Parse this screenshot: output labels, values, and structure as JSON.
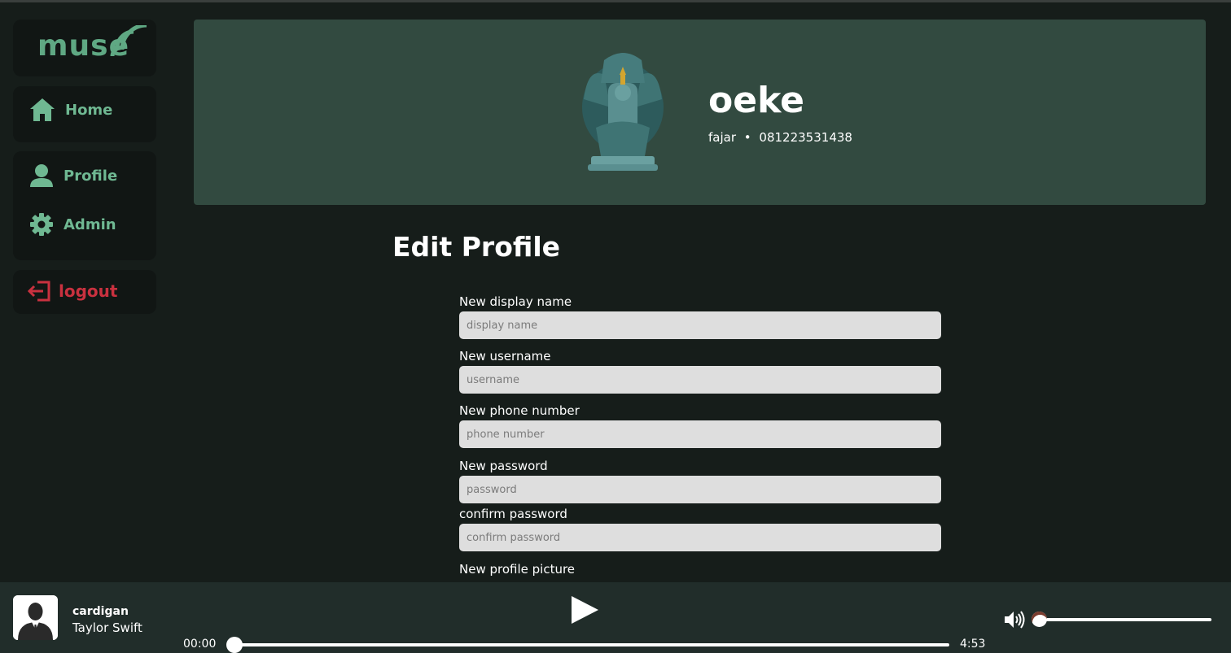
{
  "app": {
    "logo_text": "muse"
  },
  "sidebar": {
    "items": [
      {
        "label": "Home",
        "icon": "home-icon"
      },
      {
        "label": "Profile",
        "icon": "user-icon"
      },
      {
        "label": "Admin",
        "icon": "gear-icon"
      }
    ],
    "logout_label": "logout"
  },
  "profile": {
    "name": "oeke",
    "username": "fajar",
    "separator": "•",
    "phone": "081223531438"
  },
  "form": {
    "title": "Edit Profile",
    "fields": [
      {
        "label": "New display name",
        "placeholder": "display name",
        "value": ""
      },
      {
        "label": "New username",
        "placeholder": "username",
        "value": ""
      },
      {
        "label": "New phone number",
        "placeholder": "phone number",
        "value": ""
      },
      {
        "label": "New password",
        "placeholder": "password",
        "value": ""
      },
      {
        "label": "confirm password",
        "placeholder": "confirm password",
        "value": ""
      }
    ],
    "picture_label": "New profile picture"
  },
  "player": {
    "title": "cardigan",
    "artist": "Taylor Swift",
    "current_time": "00:00",
    "duration": "4:53",
    "progress": 0,
    "volume": 0.05
  },
  "colors": {
    "accent": "#6fb892",
    "danger": "#c9313f",
    "banner": "#324a40",
    "background": "#161d1a"
  }
}
